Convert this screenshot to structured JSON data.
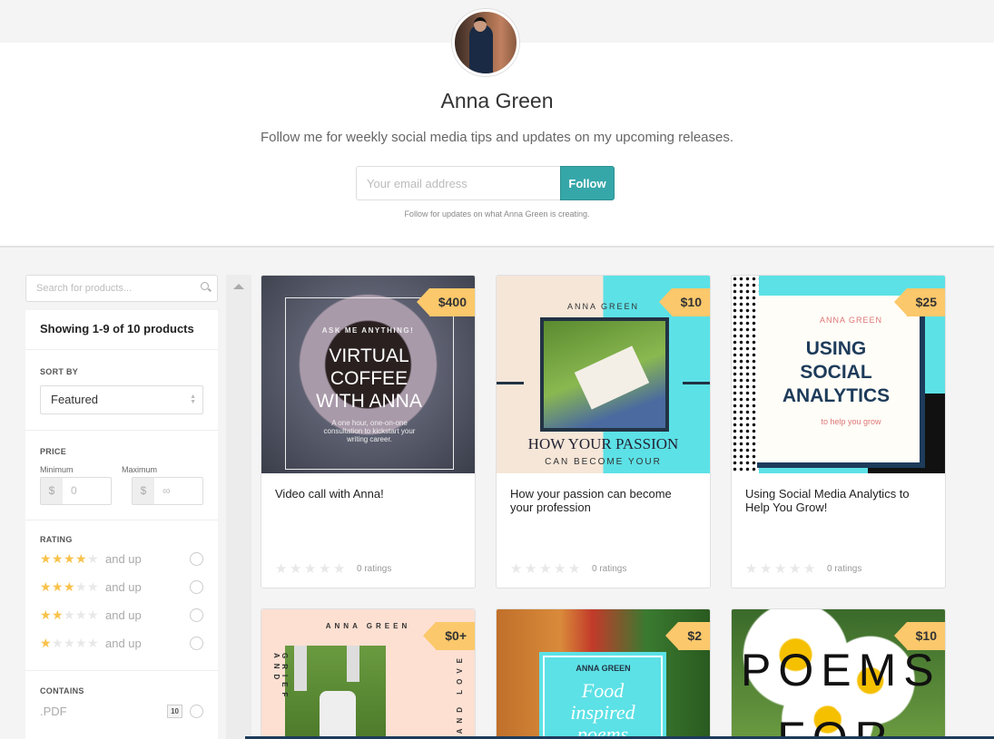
{
  "profile": {
    "name": "Anna Green",
    "tagline": "Follow me for weekly social media tips and updates on my upcoming releases.",
    "email_placeholder": "Your email address",
    "follow_label": "Follow",
    "follow_note": "Follow for updates on what Anna Green is creating."
  },
  "sidebar": {
    "search_placeholder": "Search for products...",
    "showing": "Showing 1-9 of 10 products",
    "sort_label": "SORT BY",
    "sort_value": "Featured",
    "price_label": "PRICE",
    "min_label": "Minimum",
    "max_label": "Maximum",
    "currency": "$",
    "min_value": "0",
    "max_value": "∞",
    "rating_label": "RATING",
    "ratings": [
      {
        "stars": 4,
        "text": "and up"
      },
      {
        "stars": 3,
        "text": "and up"
      },
      {
        "stars": 2,
        "text": "and up"
      },
      {
        "stars": 1,
        "text": "and up"
      }
    ],
    "contains_label": "CONTAINS",
    "contains": [
      {
        "type": ".PDF",
        "count": "10"
      }
    ]
  },
  "colors": {
    "accent": "#36a7a9",
    "price_tag": "#fbc86b",
    "star": "#f9c24b"
  },
  "products": [
    {
      "title": "Video call with Anna!",
      "price": "$400",
      "ratings": "0 ratings",
      "cover": {
        "kicker": "ASK ME ANYTHING!",
        "headline": "VIRTUAL COFFEE WITH ANNA",
        "sub": "A one hour, one-on-one consultation to kickstart your writing career."
      }
    },
    {
      "title": "How your passion can become your profession",
      "price": "$10",
      "ratings": "0 ratings",
      "cover": {
        "kicker": "ANNA GREEN",
        "headline": "HOW YOUR PASSION",
        "sub": "CAN BECOME YOUR"
      }
    },
    {
      "title": "Using Social Media Analytics to Help You Grow!",
      "price": "$25",
      "ratings": "0 ratings",
      "cover": {
        "kicker": "ANNA GREEN",
        "headline": "USING SOCIAL ANALYTICS",
        "sub": "to help you grow"
      }
    },
    {
      "price": "$0+",
      "cover": {
        "kicker": "ANNA GREEN",
        "left": "GRIEF AND",
        "right": "AND LOVE"
      }
    },
    {
      "price": "$2",
      "cover": {
        "kicker": "ANNA GREEN",
        "headline": "Food inspired poems"
      }
    },
    {
      "price": "$10",
      "cover": {
        "headline": "POEMS FOR"
      }
    }
  ]
}
